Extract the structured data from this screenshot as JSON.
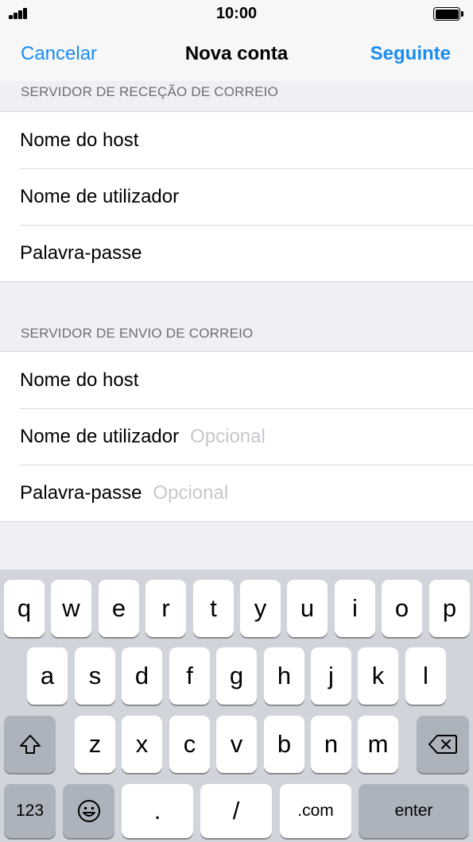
{
  "status_bar": {
    "time": "10:00"
  },
  "nav": {
    "cancel_label": "Cancelar",
    "title": "Nova conta",
    "next_label": "Seguinte"
  },
  "incoming": {
    "header": "SERVIDOR DE RECEÇÃO DE CORREIO",
    "rows": [
      {
        "label": "Nome do host",
        "placeholder": ""
      },
      {
        "label": "Nome de utilizador",
        "placeholder": ""
      },
      {
        "label": "Palavra-passe",
        "placeholder": ""
      }
    ]
  },
  "outgoing": {
    "header": "SERVIDOR DE ENVIO DE CORREIO",
    "rows": [
      {
        "label": "Nome do host",
        "placeholder": ""
      },
      {
        "label": "Nome de utilizador",
        "placeholder": "Opcional"
      },
      {
        "label": "Palavra-passe",
        "placeholder": "Opcional"
      }
    ]
  },
  "keyboard": {
    "row1": [
      "q",
      "w",
      "e",
      "r",
      "t",
      "y",
      "u",
      "i",
      "o",
      "p"
    ],
    "row2": [
      "a",
      "s",
      "d",
      "f",
      "g",
      "h",
      "j",
      "k",
      "l"
    ],
    "row3": [
      "z",
      "x",
      "c",
      "v",
      "b",
      "n",
      "m"
    ],
    "numbers_key": "123",
    "period_key": ".",
    "slash_key": "/",
    "dotcom_key": ".com",
    "enter_key": "enter",
    "icons": {
      "shift": "shift-icon",
      "backspace": "backspace-icon",
      "emoji": "emoji-icon"
    }
  },
  "colors": {
    "accent": "#1a8cf0",
    "background": "#efeff4",
    "keyboard": "#d1d5db",
    "placeholder": "#c7c7cd"
  }
}
